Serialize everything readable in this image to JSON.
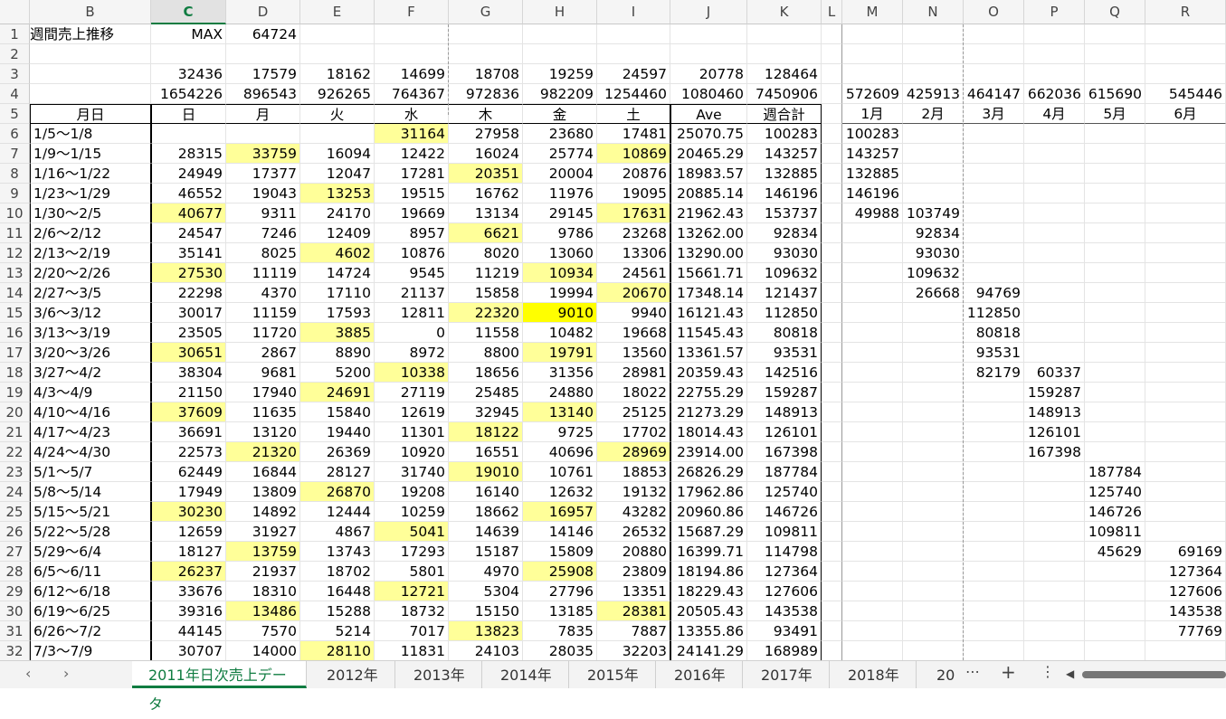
{
  "columns": [
    "B",
    "C",
    "D",
    "E",
    "F",
    "G",
    "H",
    "I",
    "J",
    "K",
    "L",
    "M",
    "N",
    "O",
    "P",
    "Q",
    "R"
  ],
  "selected_column": "C",
  "rows": [
    {
      "n": "1",
      "cells": {
        "B": "週間売上推移",
        "C": "MAX",
        "D": "64724"
      }
    },
    {
      "n": "2",
      "cells": {}
    },
    {
      "n": "3",
      "cells": {
        "C": "32436",
        "D": "17579",
        "E": "18162",
        "F": "14699",
        "G": "18708",
        "H": "19259",
        "I": "24597",
        "J": "20778",
        "K": "128464"
      }
    },
    {
      "n": "4",
      "cells": {
        "C": "1654226",
        "D": "896543",
        "E": "926265",
        "F": "764367",
        "G": "972836",
        "H": "982209",
        "I": "1254460",
        "J": "1080460",
        "K": "7450906",
        "M": "572609",
        "N": "425913",
        "O": "464147",
        "P": "662036",
        "Q": "615690",
        "R": "545446"
      }
    },
    {
      "n": "5",
      "cells": {
        "B": "月日",
        "C": "日",
        "D": "月",
        "E": "火",
        "F": "水",
        "G": "木",
        "H": "金",
        "I": "土",
        "J": "Ave",
        "K": "週合計",
        "M": "1月",
        "N": "2月",
        "O": "3月",
        "P": "4月",
        "Q": "5月",
        "R": "6月"
      }
    },
    {
      "n": "6",
      "cells": {
        "B": "1/5～1/8",
        "F": "31164",
        "G": "27958",
        "H": "23680",
        "I": "17481",
        "J": "25070.75",
        "K": "100283",
        "M": "100283"
      },
      "hl": {
        "F": "y"
      }
    },
    {
      "n": "7",
      "cells": {
        "B": "1/9～1/15",
        "C": "28315",
        "D": "33759",
        "E": "16094",
        "F": "12422",
        "G": "16024",
        "H": "25774",
        "I": "10869",
        "J": "20465.29",
        "K": "143257",
        "M": "143257"
      },
      "hl": {
        "D": "y",
        "I": "y"
      }
    },
    {
      "n": "8",
      "cells": {
        "B": "1/16～1/22",
        "C": "24949",
        "D": "17377",
        "E": "12047",
        "F": "17281",
        "G": "20351",
        "H": "20004",
        "I": "20876",
        "J": "18983.57",
        "K": "132885",
        "M": "132885"
      },
      "hl": {
        "G": "y"
      }
    },
    {
      "n": "9",
      "cells": {
        "B": "1/23～1/29",
        "C": "46552",
        "D": "19043",
        "E": "13253",
        "F": "19515",
        "G": "16762",
        "H": "11976",
        "I": "19095",
        "J": "20885.14",
        "K": "146196",
        "M": "146196"
      },
      "hl": {
        "E": "y"
      }
    },
    {
      "n": "10",
      "cells": {
        "B": "1/30～2/5",
        "C": "40677",
        "D": "9311",
        "E": "24170",
        "F": "19669",
        "G": "13134",
        "H": "29145",
        "I": "17631",
        "J": "21962.43",
        "K": "153737",
        "M": "49988",
        "N": "103749"
      },
      "hl": {
        "C": "y",
        "I": "y"
      }
    },
    {
      "n": "11",
      "cells": {
        "B": "2/6～2/12",
        "C": "24547",
        "D": "7246",
        "E": "12409",
        "F": "8957",
        "G": "6621",
        "H": "9786",
        "I": "23268",
        "J": "13262.00",
        "K": "92834",
        "N": "92834"
      },
      "hl": {
        "G": "y"
      }
    },
    {
      "n": "12",
      "cells": {
        "B": "2/13～2/19",
        "C": "35141",
        "D": "8025",
        "E": "4602",
        "F": "10876",
        "G": "8020",
        "H": "13060",
        "I": "13306",
        "J": "13290.00",
        "K": "93030",
        "N": "93030"
      },
      "hl": {
        "E": "y"
      }
    },
    {
      "n": "13",
      "cells": {
        "B": "2/20～2/26",
        "C": "27530",
        "D": "11119",
        "E": "14724",
        "F": "9545",
        "G": "11219",
        "H": "10934",
        "I": "24561",
        "J": "15661.71",
        "K": "109632",
        "N": "109632"
      },
      "hl": {
        "C": "y",
        "H": "y"
      }
    },
    {
      "n": "14",
      "cells": {
        "B": "2/27～3/5",
        "C": "22298",
        "D": "4370",
        "E": "17110",
        "F": "21137",
        "G": "15858",
        "H": "19994",
        "I": "20670",
        "J": "17348.14",
        "K": "121437",
        "N": "26668",
        "O": "94769"
      },
      "hl": {
        "I": "y"
      }
    },
    {
      "n": "15",
      "cells": {
        "B": "3/6～3/12",
        "C": "30017",
        "D": "11159",
        "E": "17593",
        "F": "12811",
        "G": "22320",
        "H": "9010",
        "I": "9940",
        "J": "16121.43",
        "K": "112850",
        "O": "112850"
      },
      "hl": {
        "G": "y",
        "H": "Y"
      }
    },
    {
      "n": "16",
      "cells": {
        "B": "3/13～3/19",
        "C": "23505",
        "D": "11720",
        "E": "3885",
        "F": "0",
        "G": "11558",
        "H": "10482",
        "I": "19668",
        "J": "11545.43",
        "K": "80818",
        "O": "80818"
      },
      "hl": {
        "E": "y"
      }
    },
    {
      "n": "17",
      "cells": {
        "B": "3/20～3/26",
        "C": "30651",
        "D": "2867",
        "E": "8890",
        "F": "8972",
        "G": "8800",
        "H": "19791",
        "I": "13560",
        "J": "13361.57",
        "K": "93531",
        "O": "93531"
      },
      "hl": {
        "C": "y",
        "H": "y"
      }
    },
    {
      "n": "18",
      "cells": {
        "B": "3/27～4/2",
        "C": "38304",
        "D": "9681",
        "E": "5200",
        "F": "10338",
        "G": "18656",
        "H": "31356",
        "I": "28981",
        "J": "20359.43",
        "K": "142516",
        "O": "82179",
        "P": "60337"
      },
      "hl": {
        "F": "y"
      }
    },
    {
      "n": "19",
      "cells": {
        "B": "4/3～4/9",
        "C": "21150",
        "D": "17940",
        "E": "24691",
        "F": "27119",
        "G": "25485",
        "H": "24880",
        "I": "18022",
        "J": "22755.29",
        "K": "159287",
        "P": "159287"
      },
      "hl": {
        "E": "y"
      }
    },
    {
      "n": "20",
      "cells": {
        "B": "4/10～4/16",
        "C": "37609",
        "D": "11635",
        "E": "15840",
        "F": "12619",
        "G": "32945",
        "H": "13140",
        "I": "25125",
        "J": "21273.29",
        "K": "148913",
        "P": "148913"
      },
      "hl": {
        "C": "y",
        "H": "y"
      }
    },
    {
      "n": "21",
      "cells": {
        "B": "4/17～4/23",
        "C": "36691",
        "D": "13120",
        "E": "19440",
        "F": "11301",
        "G": "18122",
        "H": "9725",
        "I": "17702",
        "J": "18014.43",
        "K": "126101",
        "P": "126101"
      },
      "hl": {
        "G": "y"
      }
    },
    {
      "n": "22",
      "cells": {
        "B": "4/24～4/30",
        "C": "22573",
        "D": "21320",
        "E": "26369",
        "F": "10920",
        "G": "16551",
        "H": "40696",
        "I": "28969",
        "J": "23914.00",
        "K": "167398",
        "P": "167398"
      },
      "hl": {
        "D": "y",
        "I": "y"
      }
    },
    {
      "n": "23",
      "cells": {
        "B": "5/1～5/7",
        "C": "62449",
        "D": "16844",
        "E": "28127",
        "F": "31740",
        "G": "19010",
        "H": "10761",
        "I": "18853",
        "J": "26826.29",
        "K": "187784",
        "Q": "187784"
      },
      "hl": {
        "G": "y"
      }
    },
    {
      "n": "24",
      "cells": {
        "B": "5/8～5/14",
        "C": "17949",
        "D": "13809",
        "E": "26870",
        "F": "19208",
        "G": "16140",
        "H": "12632",
        "I": "19132",
        "J": "17962.86",
        "K": "125740",
        "Q": "125740"
      },
      "hl": {
        "E": "y"
      }
    },
    {
      "n": "25",
      "cells": {
        "B": "5/15～5/21",
        "C": "30230",
        "D": "14892",
        "E": "12444",
        "F": "10259",
        "G": "18662",
        "H": "16957",
        "I": "43282",
        "J": "20960.86",
        "K": "146726",
        "Q": "146726"
      },
      "hl": {
        "C": "y",
        "H": "y"
      }
    },
    {
      "n": "26",
      "cells": {
        "B": "5/22～5/28",
        "C": "12659",
        "D": "31927",
        "E": "4867",
        "F": "5041",
        "G": "14639",
        "H": "14146",
        "I": "26532",
        "J": "15687.29",
        "K": "109811",
        "Q": "109811"
      },
      "hl": {
        "F": "y"
      }
    },
    {
      "n": "27",
      "cells": {
        "B": "5/29～6/4",
        "C": "18127",
        "D": "13759",
        "E": "13743",
        "F": "17293",
        "G": "15187",
        "H": "15809",
        "I": "20880",
        "J": "16399.71",
        "K": "114798",
        "Q": "45629",
        "R": "69169"
      },
      "hl": {
        "D": "y"
      }
    },
    {
      "n": "28",
      "cells": {
        "B": "6/5～6/11",
        "C": "26237",
        "D": "21937",
        "E": "18702",
        "F": "5801",
        "G": "4970",
        "H": "25908",
        "I": "23809",
        "J": "18194.86",
        "K": "127364",
        "R": "127364"
      },
      "hl": {
        "C": "y",
        "H": "y"
      }
    },
    {
      "n": "29",
      "cells": {
        "B": "6/12～6/18",
        "C": "33676",
        "D": "18310",
        "E": "16448",
        "F": "12721",
        "G": "5304",
        "H": "27796",
        "I": "13351",
        "J": "18229.43",
        "K": "127606",
        "R": "127606"
      },
      "hl": {
        "F": "y"
      }
    },
    {
      "n": "30",
      "cells": {
        "B": "6/19～6/25",
        "C": "39316",
        "D": "13486",
        "E": "15288",
        "F": "18732",
        "G": "15150",
        "H": "13185",
        "I": "28381",
        "J": "20505.43",
        "K": "143538",
        "R": "143538"
      },
      "hl": {
        "D": "y",
        "I": "y"
      }
    },
    {
      "n": "31",
      "cells": {
        "B": "6/26～7/2",
        "C": "44145",
        "D": "7570",
        "E": "5214",
        "F": "7017",
        "G": "13823",
        "H": "7835",
        "I": "7887",
        "J": "13355.86",
        "K": "93491",
        "R": "77769"
      },
      "hl": {
        "G": "y"
      }
    },
    {
      "n": "32",
      "cells": {
        "B": "7/3～7/9",
        "C": "30707",
        "D": "14000",
        "E": "28110",
        "F": "11831",
        "G": "24103",
        "H": "28035",
        "I": "32203",
        "J": "24141.29",
        "K": "168989"
      },
      "hl": {
        "E": "y"
      }
    }
  ],
  "tabs": {
    "prev_label": "‹",
    "next_label": "›",
    "sheets": [
      "2011年日次売上データ",
      "2012年",
      "2013年",
      "2014年",
      "2015年",
      "2016年",
      "2017年",
      "2018年",
      "20"
    ],
    "active_index": 0,
    "more_label": "⋯",
    "add_label": "+",
    "menu_label": "⋮",
    "scroll_left_label": "◀"
  },
  "colors": {
    "highlight": "#ffff99",
    "highlight_strong": "#ffff00",
    "accent": "#107c41"
  }
}
